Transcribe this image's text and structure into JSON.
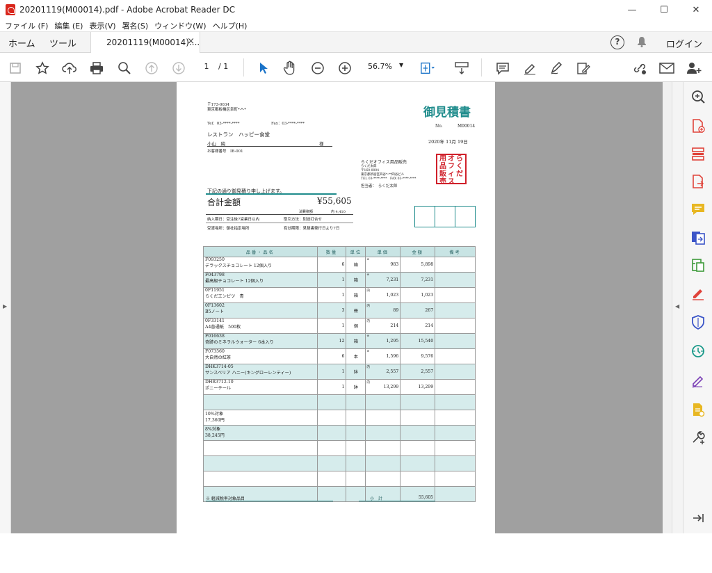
{
  "window": {
    "title": "20201119(M00014).pdf - Adobe Acrobat Reader DC",
    "min": "—",
    "max": "☐",
    "close": "✕"
  },
  "menu": [
    "ファイル (F)",
    "編集 (E)",
    "表示(V)",
    "署名(S)",
    "ウィンドウ(W)",
    "ヘルプ(H)"
  ],
  "tabs": {
    "home": "ホーム",
    "tools": "ツール",
    "doc": "20201119(M00014)....",
    "close": "×"
  },
  "header": {
    "help": "?",
    "login": "ログイン"
  },
  "toolbar": {
    "page_current": "1",
    "page_total": "/ 1",
    "zoom": "56.7%",
    "zoom_caret": "▼"
  },
  "doc": {
    "zip": "〒173-0034",
    "address": "東京都板橋区幸町*-*-*",
    "tel": "Tel：03-****-****",
    "fax": "Fax：03-****-****",
    "title": "御見積書",
    "no_label": "No.",
    "no_value": "M00014",
    "date": "2020年 11月 19日",
    "customer_name": "レストラン　ハッピー食堂",
    "contact": "小山　純",
    "honorific": "様",
    "customer_no": "お客様番号　IB-001",
    "vendor_name": "らくだオフィス用品販売",
    "vendor_person": "らくだ太郎",
    "vendor_zip": "〒160-0004",
    "vendor_addr": "東京都新宿区四谷*-**四谷ビル",
    "vendor_telfax": "TEL 03-****-****　FAX 03-****-****",
    "vendor_rep": "担当者：　らくだ太郎",
    "stamp": [
      "らくだ",
      "オフィス",
      "用品販売"
    ],
    "intro": "下記の通り御見積り申し上げます。",
    "total_label": "合計金額",
    "total_value": "¥55,605",
    "tax_label": "消費税額",
    "tax_value": "内 4,410",
    "delivery": "納入期日：受注後7営業日以内",
    "payment": "取引方法：別途打合せ",
    "place": "受渡場所：御社指定場所",
    "validity": "有効期限：見積書発行日より7日",
    "cols": [
      "品番・品名",
      "数量",
      "単位",
      "単価",
      "金額",
      "備考"
    ],
    "items": [
      {
        "code": "F093250",
        "name": "デラックスチョコレート 12個入り",
        "qty": "6",
        "unit": "箱",
        "mark": "※",
        "price": "983",
        "amount": "5,898"
      },
      {
        "code": "F043798",
        "name": "最高級チョコレート 12個入り",
        "qty": "1",
        "unit": "箱",
        "mark": "※",
        "price": "7,231",
        "amount": "7,231"
      },
      {
        "code": "0F11951",
        "name": "らくだエンピツ　青",
        "qty": "1",
        "unit": "箱",
        "mark": "内",
        "price": "1,023",
        "amount": "1,023"
      },
      {
        "code": "0F13602",
        "name": "B5ノート",
        "qty": "3",
        "unit": "冊",
        "mark": "内",
        "price": "89",
        "amount": "267"
      },
      {
        "code": "0F33141",
        "name": "A4普通紙　500枚",
        "qty": "1",
        "unit": "個",
        "mark": "内",
        "price": "214",
        "amount": "214"
      },
      {
        "code": "F016638",
        "name": "奇跡のミネラルウォーター 6本入り",
        "qty": "12",
        "unit": "箱",
        "mark": "※",
        "price": "1,295",
        "amount": "15,540"
      },
      {
        "code": "F073560",
        "name": "大自然の紅茶",
        "qty": "6",
        "unit": "本",
        "mark": "※",
        "price": "1,596",
        "amount": "9,576"
      },
      {
        "code": "DHK3714-05",
        "name": "サンスベリア ハニー(キングローレンティー)",
        "qty": "1",
        "unit": "鉢",
        "mark": "内",
        "price": "2,557",
        "amount": "2,557"
      },
      {
        "code": "DHR3712-10",
        "name": "ポニーテール",
        "qty": "1",
        "unit": "鉢",
        "mark": "内",
        "price": "13,299",
        "amount": "13,299"
      }
    ],
    "tax10_label": "10%対象",
    "tax10_value": "17,360円",
    "tax8_label": "8%対象",
    "tax8_value": "38,245円",
    "reduced_note": "※ 軽減税率対象品目",
    "subtotal_label": "小　計",
    "subtotal_value": "55,605"
  }
}
